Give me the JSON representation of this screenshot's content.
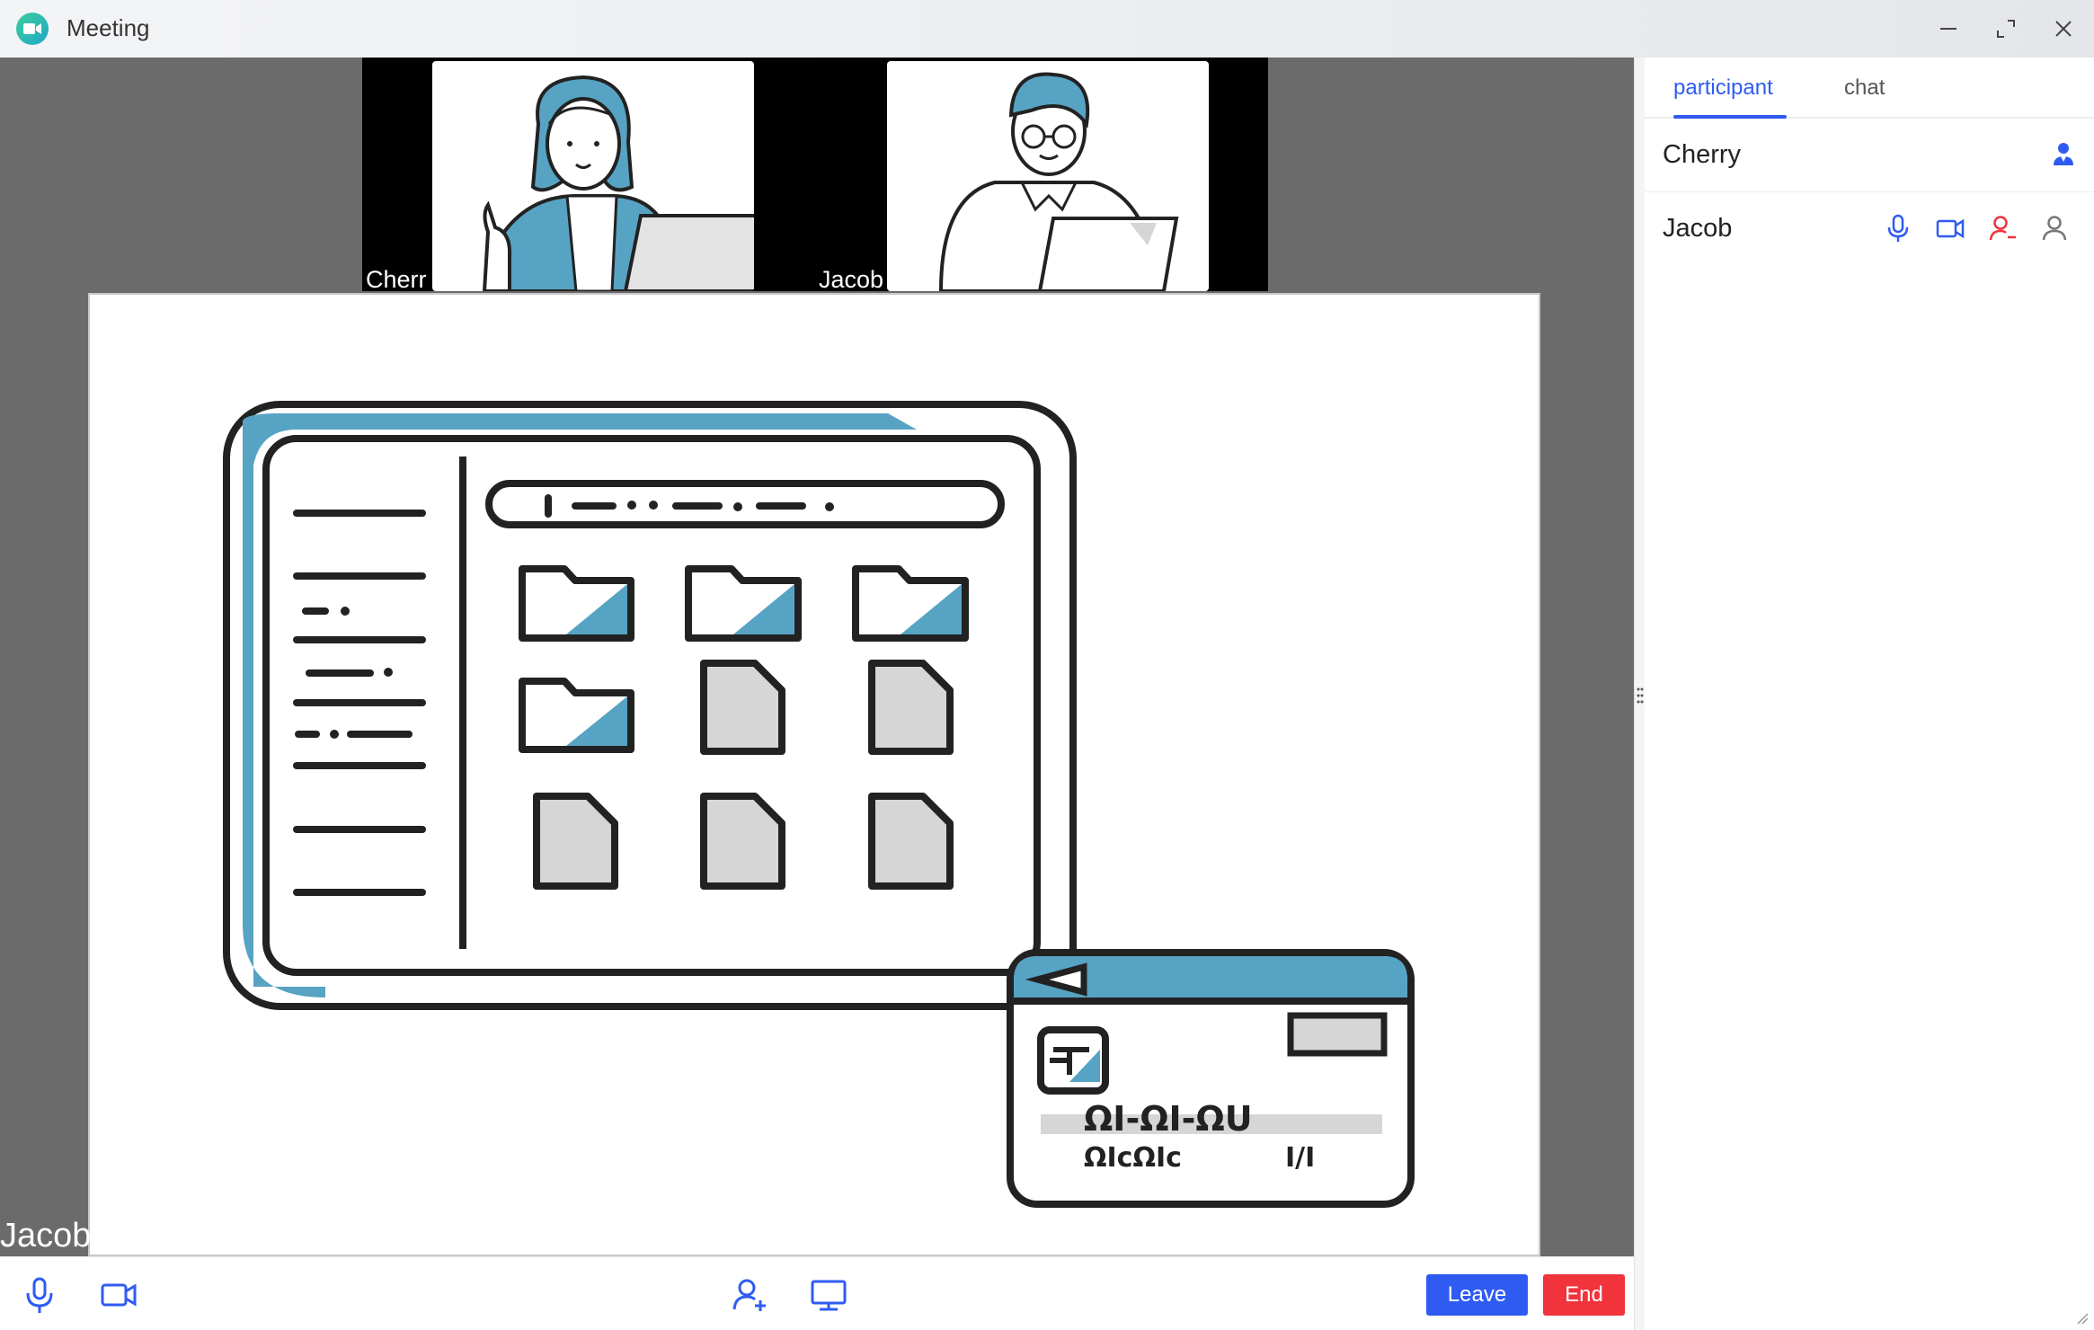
{
  "window": {
    "title": "Meeting"
  },
  "thumbnails": [
    {
      "name": "Cherry",
      "label": "Cherr"
    },
    {
      "name": "Jacob",
      "label": "Jacob"
    }
  ],
  "stage": {
    "speaker_label": "Jacob",
    "shared_content": "file-manager-illustration"
  },
  "shared_illustration": {
    "card_text_line1": "ΩI-ΩI-ΩU",
    "card_text_line2": "ΩIᴄΩIᴄ",
    "card_text_short": "I/I"
  },
  "toolbar": {
    "leave_label": "Leave",
    "end_label": "End"
  },
  "panel": {
    "tabs": [
      {
        "label": "participant",
        "active": true
      },
      {
        "label": "chat",
        "active": false
      }
    ],
    "participants": [
      {
        "name": "Cherry",
        "role": "host"
      },
      {
        "name": "Jacob",
        "role": "participant"
      }
    ]
  },
  "colors": {
    "accent": "#2f5bf2",
    "danger": "#f1333c",
    "illustration_blue": "#57a3c3",
    "stage_bg": "#6b6b6b"
  }
}
